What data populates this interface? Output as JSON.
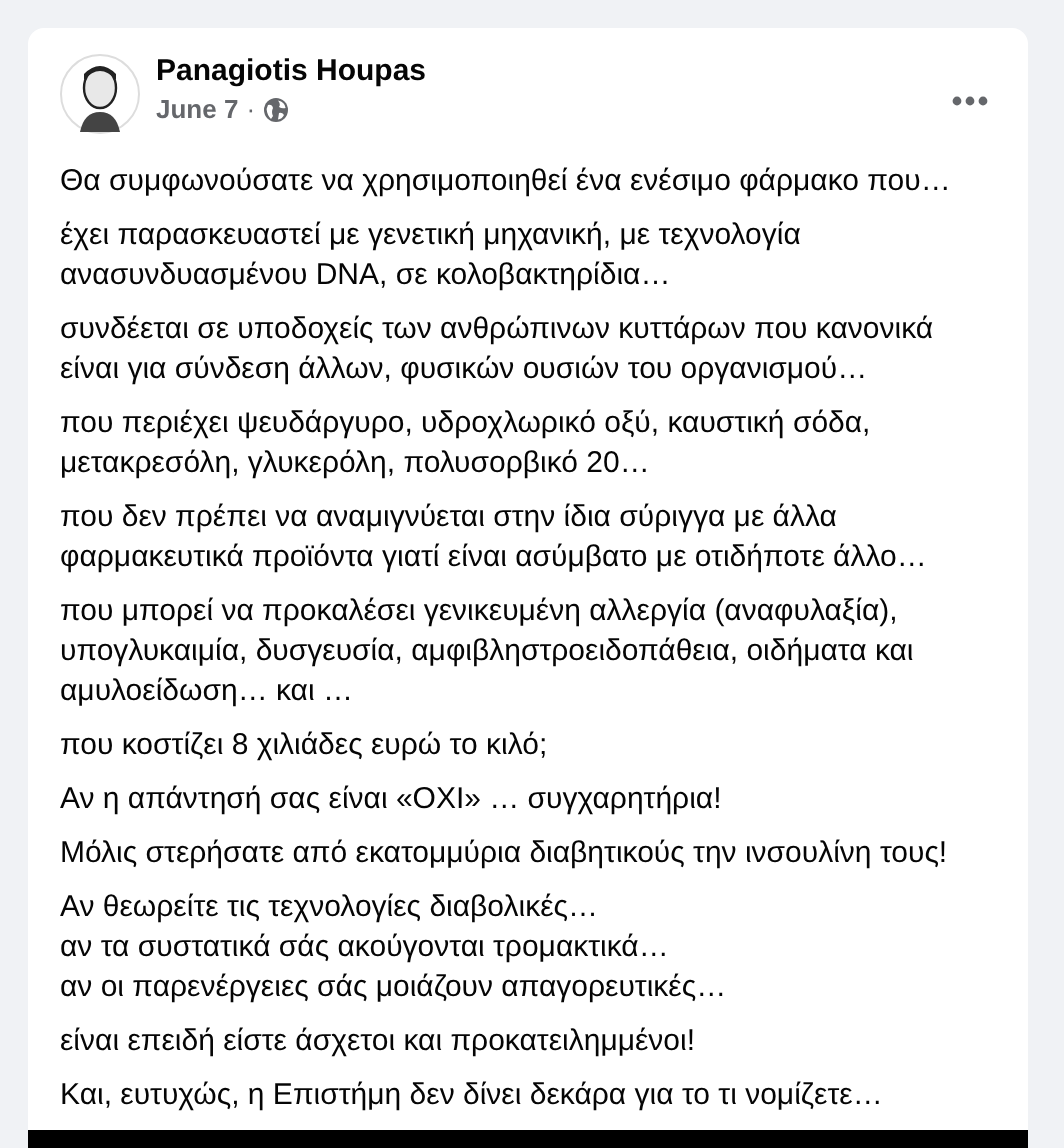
{
  "post": {
    "author": "Panagiotis Houpas",
    "date": "June 7",
    "separator": "·",
    "paragraphs": [
      [
        "Θα συμφωνούσατε να χρησιμοποιηθεί ένα ενέσιμο φάρμακο που…"
      ],
      [
        "έχει παρασκευαστεί με γενετική μηχανική, με τεχνολογία",
        "ανασυνδυασμένου DNA, σε κολοβακτηρίδια…"
      ],
      [
        "συνδέεται σε υποδοχείς των ανθρώπινων κυττάρων που κανονικά",
        "είναι για σύνδεση άλλων, φυσικών ουσιών του οργανισμού…"
      ],
      [
        "που περιέχει ψευδάργυρο, υδροχλωρικό οξύ, καυστική σόδα,",
        "μετακρεσόλη, γλυκερόλη, πολυσορβικό 20…"
      ],
      [
        "που δεν πρέπει να αναμιγνύεται στην ίδια σύριγγα με άλλα",
        "φαρμακευτικά προϊόντα γιατί είναι ασύμβατο με οτιδήποτε άλλο…"
      ],
      [
        "που μπορεί να προκαλέσει γενικευμένη αλλεργία (αναφυλαξία),",
        "υπογλυκαιμία, δυσγευσία, αμφιβληστροειδοπάθεια, οιδήματα και",
        "αμυλοείδωση… και …"
      ],
      [
        "που κοστίζει 8 χιλιάδες ευρώ το κιλό;"
      ],
      [
        "Αν η απάντησή σας είναι «ΟΧΙ» … συγχαρητήρια!"
      ],
      [
        "Μόλις στερήσατε από εκατομμύρια διαβητικούς την ινσουλίνη τους!"
      ],
      [
        "Αν θεωρείτε τις τεχνολογίες διαβολικές…",
        "αν τα συστατικά σάς ακούγονται τρομακτικά…",
        "αν οι παρενέργειες σάς μοιάζουν απαγορευτικές…"
      ],
      [
        "είναι επειδή είστε άσχετοι και προκατειλημμένοι!"
      ],
      [
        "Και, ευτυχώς, η Επιστήμη δεν δίνει δεκάρα για το τι νομίζετε…"
      ]
    ]
  }
}
